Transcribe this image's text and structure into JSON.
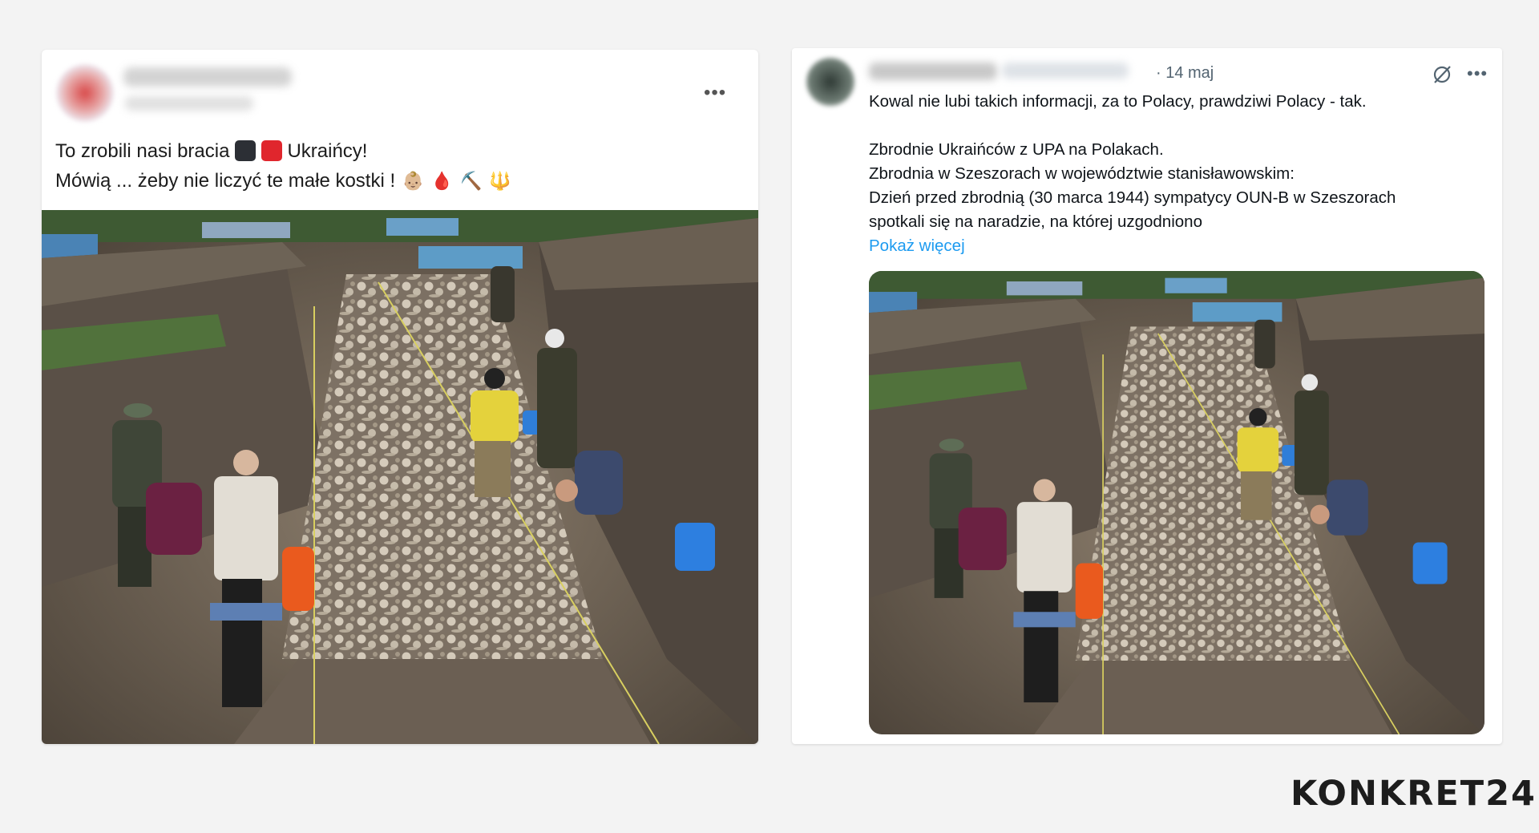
{
  "facebook_post": {
    "author_name": "",
    "post_text_line1_a": "To zrobili nasi bracia",
    "post_text_line1_b": "Ukraińcy!",
    "post_text_line2": "Mówią ... żeby nie liczyć te małe kostki !",
    "emojis_line2": [
      "👶🏼",
      "🩸",
      "⛏️",
      "🔱"
    ],
    "more_options": "•••",
    "flag_colors": [
      "#2c2f35",
      "#e0262d"
    ],
    "photo_alt_icon": "mass-grave-excavation-photo"
  },
  "twitter_post": {
    "date": "· 14 maj",
    "more_options": "•••",
    "lines": [
      "Kowal nie lubi takich informacji, za to Polacy, prawdziwi Polacy - tak.",
      "",
      "Zbrodnie Ukraińców z UPA na Polakach.",
      "Zbrodnia w Szeszorach w województwie stanisławowskim:",
      "Dzień przed zbrodnią (30 marca 1944) sympatycy OUN-B w Szeszorach",
      "spotkali się na naradzie, na której uzgodniono"
    ],
    "show_more": "Pokaż więcej",
    "link_color": "#1d9bf0",
    "photo_alt_icon": "mass-grave-excavation-photo"
  },
  "brand": {
    "name": "KONKRET24"
  }
}
